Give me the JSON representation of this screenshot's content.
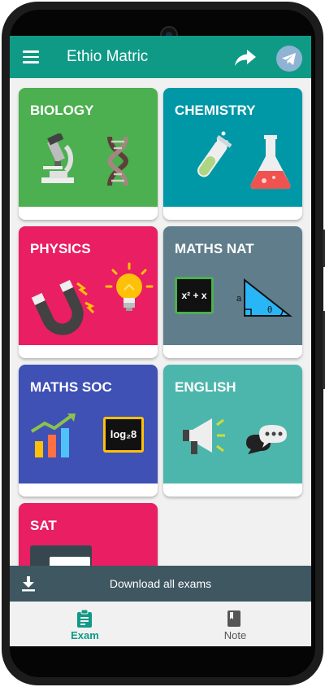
{
  "app": {
    "title": "Ethio Matric",
    "colors": {
      "primary": "#0f9a86",
      "download_bar": "#3e5761",
      "background": "#f1f1f1"
    }
  },
  "header": {
    "menu_icon": "hamburger-icon",
    "share_icon": "share-arrow-icon",
    "telegram_icon": "telegram-icon"
  },
  "subjects": [
    {
      "label": "BIOLOGY",
      "color": "#4caf50",
      "icons": [
        "microscope-icon",
        "dna-icon"
      ]
    },
    {
      "label": "CHEMISTRY",
      "color": "#0097a7",
      "icons": [
        "test-tube-icon",
        "flask-icon"
      ]
    },
    {
      "label": "PHYSICS",
      "color": "#e91e63",
      "icons": [
        "magnet-icon",
        "lightbulb-icon"
      ]
    },
    {
      "label": "MATHS NAT",
      "color": "#607d8b",
      "icons": [
        "chalkboard-icon",
        "triangle-icon"
      ],
      "chalkboard_text": "x² + x",
      "triangle_side": "a",
      "triangle_angle": "θ"
    },
    {
      "label": "MATHS SOC",
      "color": "#3f51b5",
      "icons": [
        "bar-chart-icon",
        "log-board-icon"
      ],
      "log_text": "log₂8"
    },
    {
      "label": "ENGLISH",
      "color": "#4db6ac",
      "icons": [
        "megaphone-icon",
        "speech-bubble-icon"
      ]
    },
    {
      "label": "SAT",
      "color": "#e91e63",
      "icons": [
        "board-icon"
      ]
    }
  ],
  "download": {
    "label": "Download all exams",
    "icon": "download-icon"
  },
  "bottom_nav": [
    {
      "label": "Exam",
      "icon": "clipboard-icon",
      "active": true,
      "color": "#0f9a86"
    },
    {
      "label": "Note",
      "icon": "notebook-icon",
      "active": false,
      "color": "#555555"
    }
  ]
}
